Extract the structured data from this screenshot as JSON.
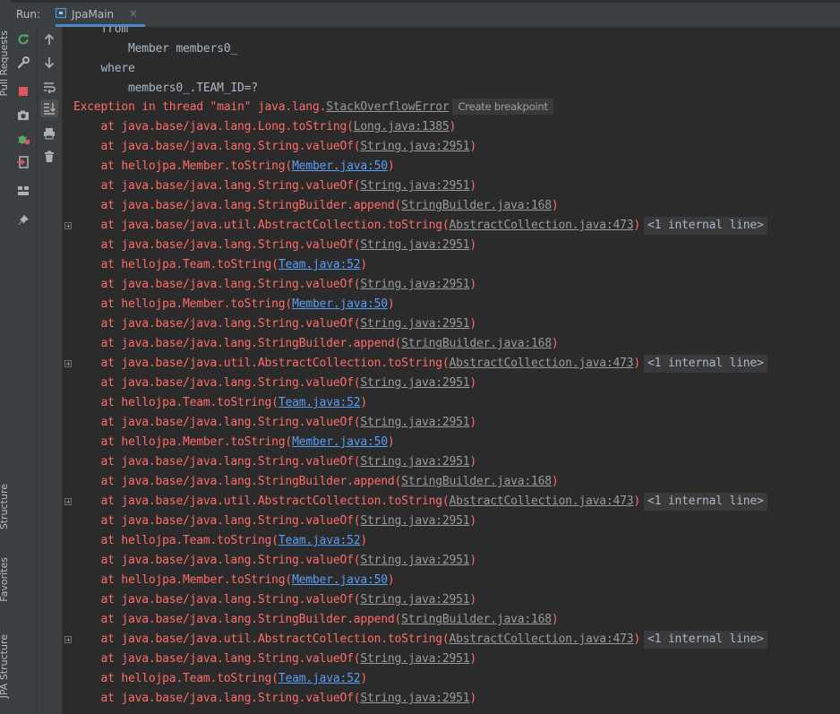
{
  "side_tabs": {
    "pull_requests": "Pull Requests",
    "structure": "Structure",
    "favorites": "Favorites",
    "jpa_structure": "JPA Structure"
  },
  "run_panel": {
    "label": "Run:",
    "tab": {
      "name": "JpaMain",
      "close": "×"
    }
  },
  "toolbar_icons": [
    "rerun-icon",
    "settings-wrench-icon",
    "stop-icon",
    "camera-icon",
    "debug-bug-icon",
    "exit-icon",
    "layout-icon",
    "pin-icon",
    "arrow-up-icon",
    "arrow-down-icon",
    "soft-wrap-icon",
    "scroll-to-end-icon",
    "print-icon",
    "trash-icon"
  ],
  "colors": {
    "error": "#ff6b68",
    "link": "#589df6",
    "background": "#2b2b2b",
    "tab_accent": "#4a88c7"
  },
  "console": {
    "sql": [
      "    from",
      "        Member members0_",
      "    where",
      "        members0_.TEAM_ID=?"
    ],
    "exception": {
      "prefix": "Exception in thread \"main\" java.lang.",
      "cls": "StackOverflowError",
      "breakpoint": "Create breakpoint"
    },
    "frames": [
      {
        "text": "    at java.base/java.lang.Long.toString(",
        "loc": "Long.java:1385",
        "link": false,
        "suffix": ")",
        "internal": "",
        "exp": false
      },
      {
        "text": "    at java.base/java.lang.String.valueOf(",
        "loc": "String.java:2951",
        "link": false,
        "suffix": ")",
        "internal": "",
        "exp": false
      },
      {
        "text": "    at hellojpa.Member.toString(",
        "loc": "Member.java:50",
        "link": true,
        "suffix": ")",
        "internal": "",
        "exp": false
      },
      {
        "text": "    at java.base/java.lang.String.valueOf(",
        "loc": "String.java:2951",
        "link": false,
        "suffix": ")",
        "internal": "",
        "exp": false
      },
      {
        "text": "    at java.base/java.lang.StringBuilder.append(",
        "loc": "StringBuilder.java:168",
        "link": false,
        "suffix": ")",
        "internal": "",
        "exp": false
      },
      {
        "text": "    at java.base/java.util.AbstractCollection.toString(",
        "loc": "AbstractCollection.java:473",
        "link": false,
        "suffix": ")",
        "internal": "<1 internal line>",
        "exp": true
      },
      {
        "text": "    at java.base/java.lang.String.valueOf(",
        "loc": "String.java:2951",
        "link": false,
        "suffix": ")",
        "internal": "",
        "exp": false
      },
      {
        "text": "    at hellojpa.Team.toString(",
        "loc": "Team.java:52",
        "link": true,
        "suffix": ")",
        "internal": "",
        "exp": false
      },
      {
        "text": "    at java.base/java.lang.String.valueOf(",
        "loc": "String.java:2951",
        "link": false,
        "suffix": ")",
        "internal": "",
        "exp": false
      },
      {
        "text": "    at hellojpa.Member.toString(",
        "loc": "Member.java:50",
        "link": true,
        "suffix": ")",
        "internal": "",
        "exp": false
      },
      {
        "text": "    at java.base/java.lang.String.valueOf(",
        "loc": "String.java:2951",
        "link": false,
        "suffix": ")",
        "internal": "",
        "exp": false
      },
      {
        "text": "    at java.base/java.lang.StringBuilder.append(",
        "loc": "StringBuilder.java:168",
        "link": false,
        "suffix": ")",
        "internal": "",
        "exp": false
      },
      {
        "text": "    at java.base/java.util.AbstractCollection.toString(",
        "loc": "AbstractCollection.java:473",
        "link": false,
        "suffix": ")",
        "internal": "<1 internal line>",
        "exp": true
      },
      {
        "text": "    at java.base/java.lang.String.valueOf(",
        "loc": "String.java:2951",
        "link": false,
        "suffix": ")",
        "internal": "",
        "exp": false
      },
      {
        "text": "    at hellojpa.Team.toString(",
        "loc": "Team.java:52",
        "link": true,
        "suffix": ")",
        "internal": "",
        "exp": false
      },
      {
        "text": "    at java.base/java.lang.String.valueOf(",
        "loc": "String.java:2951",
        "link": false,
        "suffix": ")",
        "internal": "",
        "exp": false
      },
      {
        "text": "    at hellojpa.Member.toString(",
        "loc": "Member.java:50",
        "link": true,
        "suffix": ")",
        "internal": "",
        "exp": false
      },
      {
        "text": "    at java.base/java.lang.String.valueOf(",
        "loc": "String.java:2951",
        "link": false,
        "suffix": ")",
        "internal": "",
        "exp": false
      },
      {
        "text": "    at java.base/java.lang.StringBuilder.append(",
        "loc": "StringBuilder.java:168",
        "link": false,
        "suffix": ")",
        "internal": "",
        "exp": false
      },
      {
        "text": "    at java.base/java.util.AbstractCollection.toString(",
        "loc": "AbstractCollection.java:473",
        "link": false,
        "suffix": ")",
        "internal": "<1 internal line>",
        "exp": true
      },
      {
        "text": "    at java.base/java.lang.String.valueOf(",
        "loc": "String.java:2951",
        "link": false,
        "suffix": ")",
        "internal": "",
        "exp": false
      },
      {
        "text": "    at hellojpa.Team.toString(",
        "loc": "Team.java:52",
        "link": true,
        "suffix": ")",
        "internal": "",
        "exp": false
      },
      {
        "text": "    at java.base/java.lang.String.valueOf(",
        "loc": "String.java:2951",
        "link": false,
        "suffix": ")",
        "internal": "",
        "exp": false
      },
      {
        "text": "    at hellojpa.Member.toString(",
        "loc": "Member.java:50",
        "link": true,
        "suffix": ")",
        "internal": "",
        "exp": false
      },
      {
        "text": "    at java.base/java.lang.String.valueOf(",
        "loc": "String.java:2951",
        "link": false,
        "suffix": ")",
        "internal": "",
        "exp": false
      },
      {
        "text": "    at java.base/java.lang.StringBuilder.append(",
        "loc": "StringBuilder.java:168",
        "link": false,
        "suffix": ")",
        "internal": "",
        "exp": false
      },
      {
        "text": "    at java.base/java.util.AbstractCollection.toString(",
        "loc": "AbstractCollection.java:473",
        "link": false,
        "suffix": ")",
        "internal": "<1 internal line>",
        "exp": true
      },
      {
        "text": "    at java.base/java.lang.String.valueOf(",
        "loc": "String.java:2951",
        "link": false,
        "suffix": ")",
        "internal": "",
        "exp": false
      },
      {
        "text": "    at hellojpa.Team.toString(",
        "loc": "Team.java:52",
        "link": true,
        "suffix": ")",
        "internal": "",
        "exp": false
      },
      {
        "text": "    at java.base/java.lang.String.valueOf(",
        "loc": "String.java:2951",
        "link": false,
        "suffix": ")",
        "internal": "",
        "exp": false
      }
    ]
  }
}
